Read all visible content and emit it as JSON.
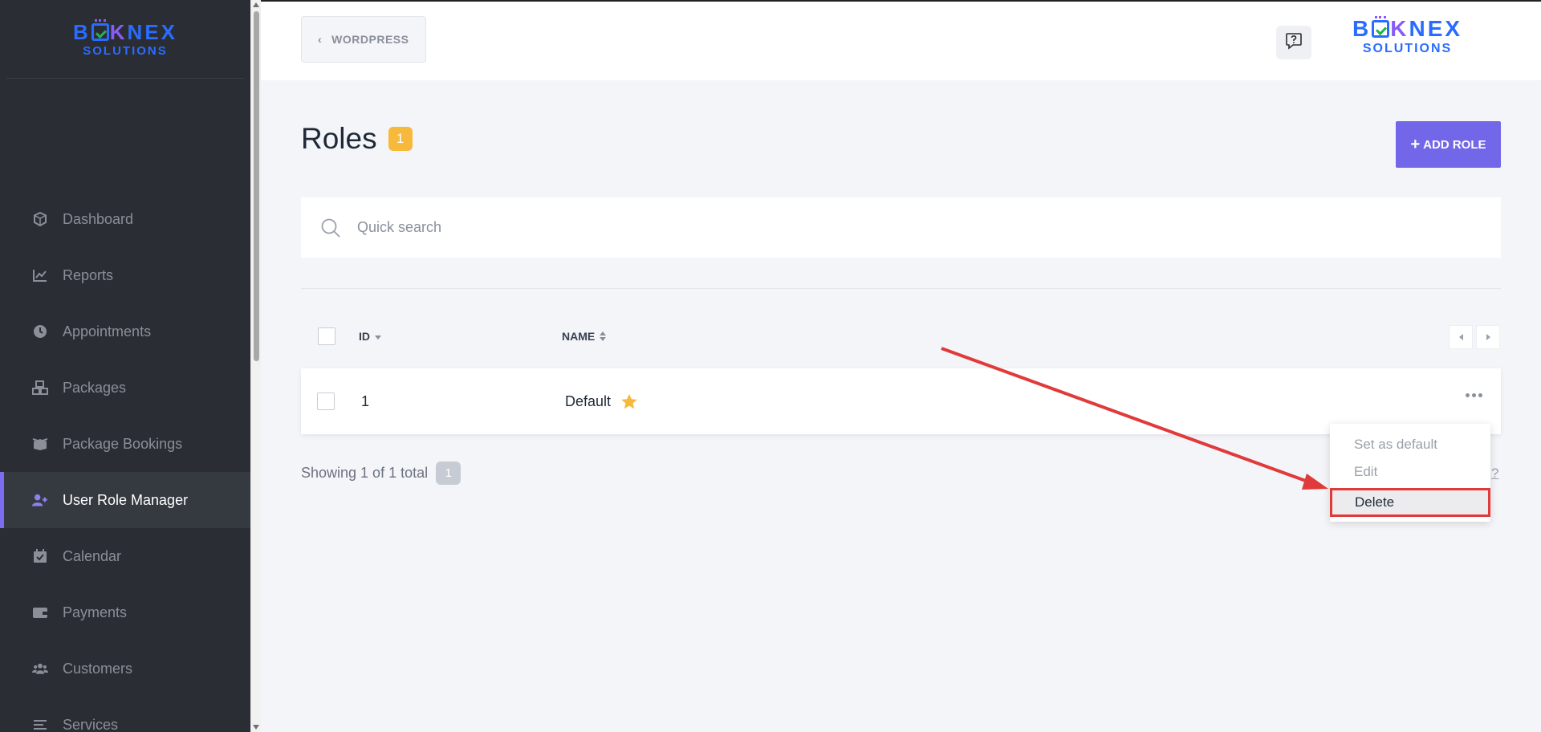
{
  "brand": {
    "logo_pre": "BO",
    "logo_k": "K",
    "logo_post": "NEX",
    "logo_sub": "SOLUTIONS"
  },
  "sidebar": {
    "items": [
      {
        "label": "Dashboard",
        "icon": "cube-icon"
      },
      {
        "label": "Reports",
        "icon": "chart-line-icon"
      },
      {
        "label": "Appointments",
        "icon": "clock-icon"
      },
      {
        "label": "Packages",
        "icon": "boxes-icon"
      },
      {
        "label": "Package Bookings",
        "icon": "box-open-icon"
      },
      {
        "label": "User Role Manager",
        "icon": "user-plus-icon",
        "active": true
      },
      {
        "label": "Calendar",
        "icon": "calendar-check-icon"
      },
      {
        "label": "Payments",
        "icon": "wallet-icon"
      },
      {
        "label": "Customers",
        "icon": "users-icon"
      },
      {
        "label": "Services",
        "icon": "list-icon"
      }
    ]
  },
  "topbar": {
    "back_label": "WORDPRESS"
  },
  "page": {
    "title": "Roles",
    "count": "1",
    "add_button": "ADD ROLE"
  },
  "search": {
    "placeholder": "Quick search"
  },
  "table": {
    "columns": [
      "ID",
      "NAME"
    ],
    "rows": [
      {
        "id": "1",
        "name": "Default",
        "is_default": true
      }
    ]
  },
  "footer": {
    "showing": "Showing 1 of 1 total",
    "total": "1",
    "help": "?"
  },
  "context_menu": {
    "items": [
      "Set as default",
      "Edit",
      "Delete"
    ],
    "highlighted": "Delete"
  },
  "colors": {
    "accent": "#7267e8",
    "badge": "#f6b93b",
    "annotation": "#e03a3a",
    "sidebar_bg": "#2a2d33"
  }
}
